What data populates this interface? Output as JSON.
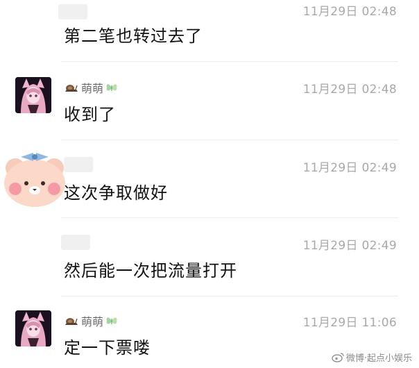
{
  "sticker_icon": "snail-icon",
  "butterfly_icon": "butterfly-icon",
  "messages": [
    {
      "sender": "",
      "time": "11月29日 02:48",
      "text": "第二笔也转过去了"
    },
    {
      "sender": "萌萌",
      "time": "11月29日 02:48",
      "text": "收到了"
    },
    {
      "sender": "",
      "time": "11月29日 02:49",
      "text": "这次争取做好"
    },
    {
      "sender": "",
      "time": "11月29日 02:49",
      "text": "然后能一次把流量打开"
    },
    {
      "sender": "萌萌",
      "time": "11月29日 11:06",
      "text": "定一下票喽"
    }
  ],
  "watermark": {
    "text": "微博·起点小娱乐"
  }
}
